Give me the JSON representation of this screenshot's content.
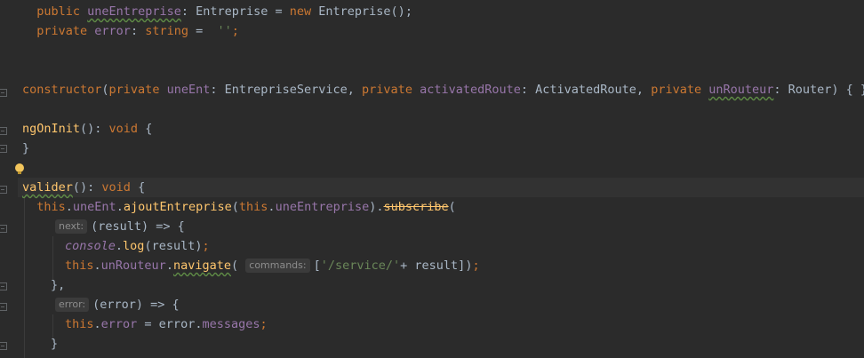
{
  "editor": {
    "line1": {
      "indent": "  ",
      "kw": "public ",
      "name": "uneEntreprise",
      "colon": ": Entreprise = ",
      "new": "new ",
      "rest": "Entreprise();"
    },
    "line2": {
      "indent": "  ",
      "kw": "private ",
      "name": "error",
      "colon": ": ",
      "type": "string",
      "eq": " =  ",
      "str": "''",
      "semi": ";"
    },
    "constructor": {
      "kw": "constructor",
      "p1": "(",
      "priv1": "private ",
      "n1": "uneEnt",
      "t1": ": EntrepriseService, ",
      "priv2": "private ",
      "n2": "activatedRoute",
      "t2": ": ActivatedRoute, ",
      "priv3": "private ",
      "n3": "unRouteur",
      "t3": ": Router) { }"
    },
    "ngOnInit": {
      "name": "ngOnInit",
      "sig": "(): ",
      "void": "void",
      "brace": " {"
    },
    "closeBrace": "}",
    "valider": {
      "name": "valider",
      "sig": "(): ",
      "void": "void",
      "brace": " {"
    },
    "subscribeLine": {
      "indent": "  ",
      "this1": "this",
      "dot1": ".",
      "ent": "uneEnt",
      "dot2": ".",
      "method": "ajoutEntreprise",
      "p": "(",
      "this2": "this",
      "dot3": ".",
      "arg": "uneEntreprise",
      "close": ").",
      "subscribe": "subscribe",
      "open": "("
    },
    "nextLine": {
      "hint": "next:",
      "code": "(result) => {"
    },
    "consoleLine": {
      "console": "console",
      "dot": ".",
      "log": "log",
      "rest": "(result)",
      "semi": ";"
    },
    "navigateLine": {
      "this": "this",
      "dot1": ".",
      "router": "unRouteur",
      "dot2": ".",
      "nav": "navigate",
      "p": "(",
      "hint": "commands:",
      "open": "[",
      "str": "'/service/'",
      "rest": "+ result]",
      "close": ")",
      "semi": ";"
    },
    "closeNext": "},",
    "errorLine": {
      "hint": "error:",
      "code": "(error) => {"
    },
    "assignLine": {
      "this": "this",
      "dot": ".",
      "field": "error",
      "mid": " = error.",
      "msgs": "messages",
      "semi": ";"
    },
    "closeErr": "}"
  }
}
